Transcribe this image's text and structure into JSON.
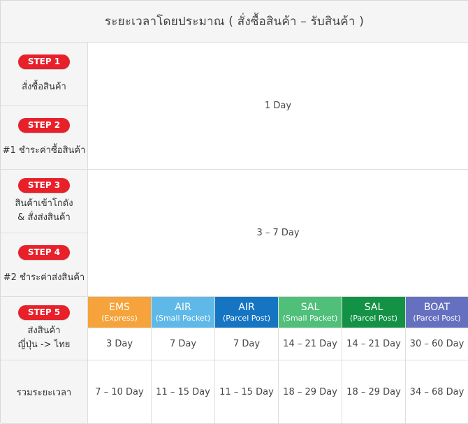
{
  "title": "ระยะเวลาโดยประมาณ ( สั่งซื้อสินค้า – รับสินค้า )",
  "steps": [
    {
      "badge": "STEP 1",
      "label": "สั่งซื้อสินค้า"
    },
    {
      "badge": "STEP 2",
      "label": "#1 ชำระค่าซื้อสินค้า"
    },
    {
      "badge": "STEP 3",
      "label": "สินค้าเข้าโกดัง\n& สั่งส่งสินค้า"
    },
    {
      "badge": "STEP 4",
      "label": "#2 ชำระค่าส่งสินค้า"
    },
    {
      "badge": "STEP 5",
      "label": "ส่งสินค้า\nญี่ปุ่น -> ไทย"
    }
  ],
  "merged": {
    "step12": "1 Day",
    "step34": "3 – 7 Day"
  },
  "methods": [
    {
      "name": "EMS",
      "sub": "(Express)",
      "color": "#f5a33a",
      "days": "3 Day",
      "total": "7 – 10 Day"
    },
    {
      "name": "AIR",
      "sub": "(Small Packet)",
      "color": "#5fb9e8",
      "days": "7 Day",
      "total": "11 – 15 Day"
    },
    {
      "name": "AIR",
      "sub": "(Parcel Post)",
      "color": "#1575c2",
      "days": "7 Day",
      "total": "11 – 15 Day"
    },
    {
      "name": "SAL",
      "sub": "(Small Packet)",
      "color": "#4fbf7a",
      "days": "14 – 21 Day",
      "total": "18 – 29 Day"
    },
    {
      "name": "SAL",
      "sub": "(Parcel Post)",
      "color": "#139245",
      "days": "14 – 21 Day",
      "total": "18 – 29 Day"
    },
    {
      "name": "BOAT",
      "sub": "(Parcel Post)",
      "color": "#6670c0",
      "days": "30 – 60 Day",
      "total": "34 – 68 Day"
    }
  ],
  "total_label": "รวมระยะเวลา"
}
